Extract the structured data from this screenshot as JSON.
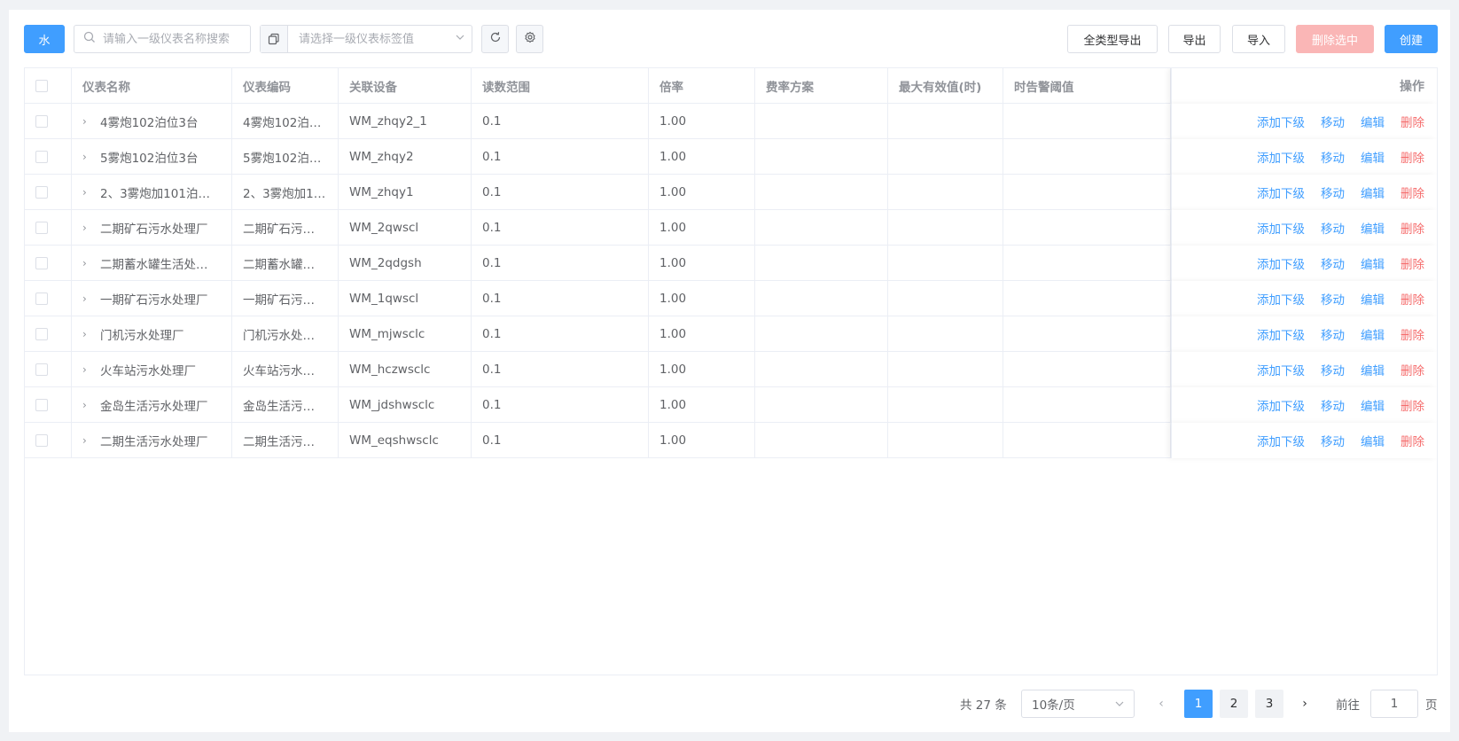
{
  "toolbar": {
    "water_tag": "水",
    "search_placeholder": "请输入一级仪表名称搜索",
    "select_placeholder": "请选择一级仪表标签值",
    "export_all_label": "全类型导出",
    "export_label": "导出",
    "import_label": "导入",
    "delete_selected_label": "删除选中",
    "create_label": "创建"
  },
  "table": {
    "columns": [
      "仪表名称",
      "仪表编码",
      "关联设备",
      "读数范围",
      "倍率",
      "费率方案",
      "最大有效值(时)",
      "时告警阈值",
      "操作"
    ],
    "rows": [
      {
        "name": "4雾炮102泊位3台",
        "code": "4雾炮102泊…",
        "device": "WM_zhqy2_1",
        "range": "0.1",
        "rate": "1.00",
        "plan": "",
        "max": "",
        "alarm": ""
      },
      {
        "name": "5雾炮102泊位3台",
        "code": "5雾炮102泊…",
        "device": "WM_zhqy2",
        "range": "0.1",
        "rate": "1.00",
        "plan": "",
        "max": "",
        "alarm": ""
      },
      {
        "name": "2、3雾炮加101泊…",
        "code": "2、3雾炮加1…",
        "device": "WM_zhqy1",
        "range": "0.1",
        "rate": "1.00",
        "plan": "",
        "max": "",
        "alarm": ""
      },
      {
        "name": "二期矿石污水处理厂",
        "code": "二期矿石污…",
        "device": "WM_2qwscl",
        "range": "0.1",
        "rate": "1.00",
        "plan": "",
        "max": "",
        "alarm": ""
      },
      {
        "name": "二期蓄水罐生活处…",
        "code": "二期蓄水罐…",
        "device": "WM_2qdgsh",
        "range": "0.1",
        "rate": "1.00",
        "plan": "",
        "max": "",
        "alarm": ""
      },
      {
        "name": "一期矿石污水处理厂",
        "code": "一期矿石污…",
        "device": "WM_1qwscl",
        "range": "0.1",
        "rate": "1.00",
        "plan": "",
        "max": "",
        "alarm": ""
      },
      {
        "name": "门机污水处理厂",
        "code": "门机污水处…",
        "device": "WM_mjwsclc",
        "range": "0.1",
        "rate": "1.00",
        "plan": "",
        "max": "",
        "alarm": ""
      },
      {
        "name": "火车站污水处理厂",
        "code": "火车站污水…",
        "device": "WM_hczwsclc",
        "range": "0.1",
        "rate": "1.00",
        "plan": "",
        "max": "",
        "alarm": ""
      },
      {
        "name": "金岛生活污水处理厂",
        "code": "金岛生活污…",
        "device": "WM_jdshwsclc",
        "range": "0.1",
        "rate": "1.00",
        "plan": "",
        "max": "",
        "alarm": ""
      },
      {
        "name": "二期生活污水处理厂",
        "code": "二期生活污…",
        "device": "WM_eqshwsclc",
        "range": "0.1",
        "rate": "1.00",
        "plan": "",
        "max": "",
        "alarm": ""
      }
    ],
    "actions": {
      "add_child": "添加下级",
      "move": "移动",
      "edit": "编辑",
      "delete": "删除"
    }
  },
  "pagination": {
    "total_text": "共 27 条",
    "page_size": "10条/页",
    "pages": [
      "1",
      "2",
      "3"
    ],
    "current_page": "1",
    "goto_label": "前往",
    "goto_value": "1",
    "page_suffix": "页"
  },
  "colors": {
    "primary": "#409eff",
    "danger": "#f56c6c",
    "danger_disabled": "#fab6b6"
  }
}
